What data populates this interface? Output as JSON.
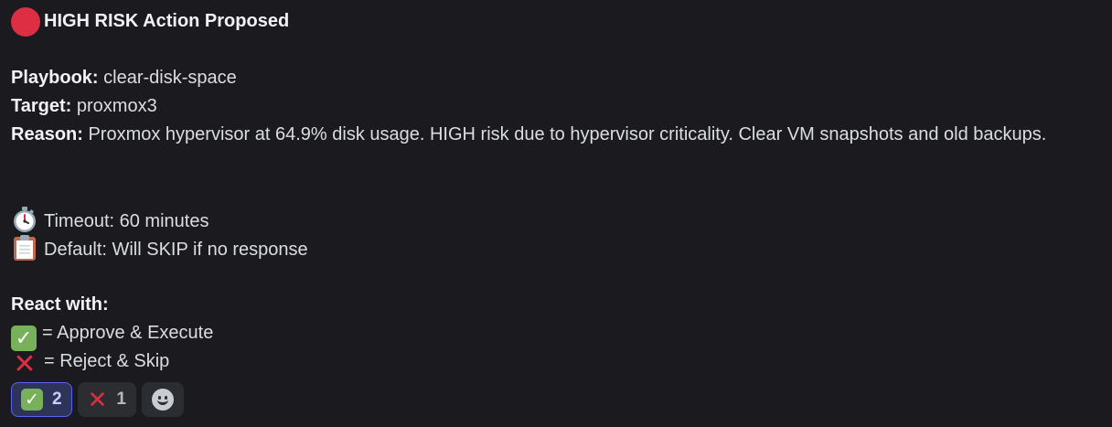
{
  "header": {
    "icon": "red-circle-icon",
    "icon_color": "#dd2e44",
    "title": "HIGH RISK Action Proposed"
  },
  "details": {
    "playbook_label": "Playbook:",
    "playbook_value": "clear-disk-space",
    "target_label": "Target:",
    "target_value": "proxmox3",
    "reason_label": "Reason:",
    "reason_value": "Proxmox hypervisor at 64.9% disk usage. HIGH risk due to hypervisor criticality. Clear VM snapshots and old backups."
  },
  "timeout": {
    "icon": "stopwatch-icon",
    "text": "Timeout: 60 minutes"
  },
  "default_action": {
    "icon": "clipboard-icon",
    "text": "Default: Will SKIP if no response"
  },
  "react_section": {
    "heading": "React with:",
    "options": [
      {
        "icon": "check-mark-icon",
        "text": "= Approve & Execute"
      },
      {
        "icon": "cross-mark-icon",
        "text": "= Reject & Skip"
      }
    ]
  },
  "reactions": [
    {
      "icon": "check-mark-icon",
      "count": "2",
      "selected": true
    },
    {
      "icon": "cross-mark-icon",
      "count": "1",
      "selected": false
    }
  ],
  "add_reaction": {
    "icon": "add-reaction-smiley-icon"
  },
  "colors": {
    "background": "#1b1b1f",
    "text": "#dbdee1",
    "check_green": "#78b159",
    "cross_red": "#dd2e44",
    "selected_reaction_border": "#5865f2"
  }
}
